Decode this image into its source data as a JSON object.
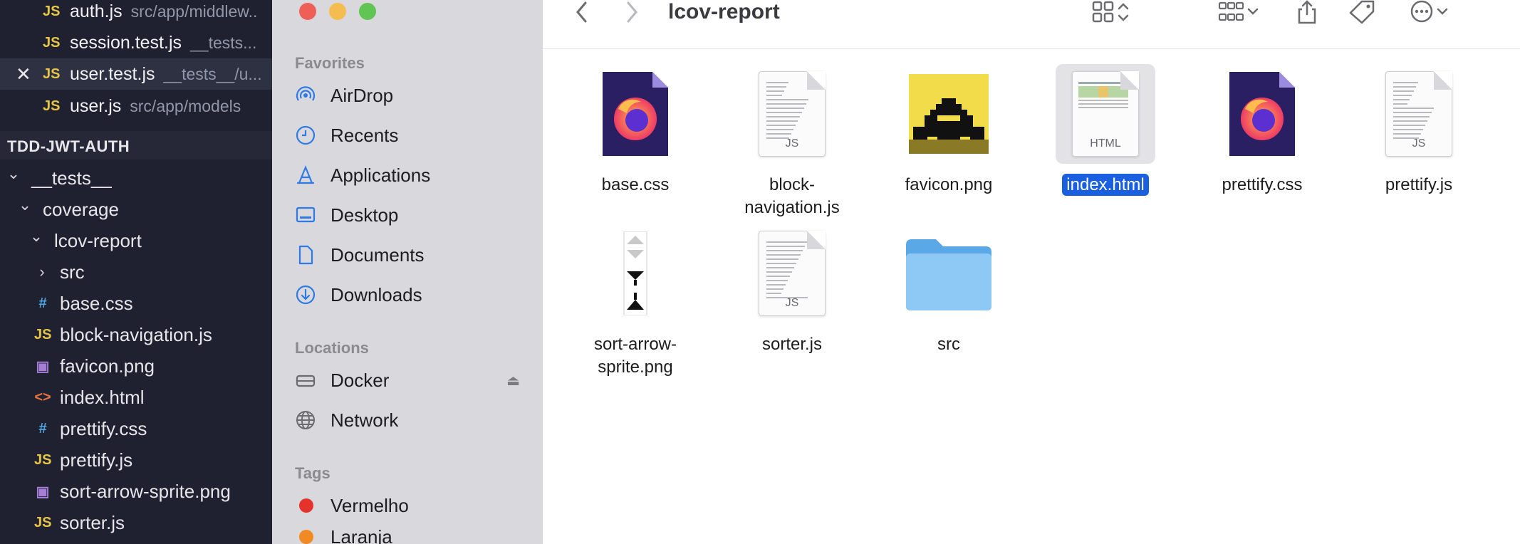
{
  "vscode": {
    "open_editors": [
      {
        "icon": "JS",
        "name": "auth.js",
        "path": "src/app/middlew..",
        "active": false
      },
      {
        "icon": "JS",
        "name": "session.test.js",
        "path": "__tests...",
        "active": false
      },
      {
        "icon": "JS",
        "name": "user.test.js",
        "path": "__tests__/u...",
        "active": true
      },
      {
        "icon": "JS",
        "name": "user.js",
        "path": "src/app/models",
        "active": false
      }
    ],
    "workspace_title": "TDD-JWT-AUTH",
    "tree": [
      {
        "label": "__tests__",
        "type": "folder",
        "expanded": true,
        "depth": 0
      },
      {
        "label": "coverage",
        "type": "folder",
        "expanded": true,
        "depth": 1
      },
      {
        "label": "lcov-report",
        "type": "folder",
        "expanded": true,
        "depth": 2
      },
      {
        "label": "src",
        "type": "folder",
        "expanded": false,
        "depth": 3
      },
      {
        "label": "base.css",
        "type": "css",
        "icon": "#",
        "depth": 3
      },
      {
        "label": "block-navigation.js",
        "type": "js",
        "icon": "JS",
        "depth": 3
      },
      {
        "label": "favicon.png",
        "type": "img",
        "icon": "▣",
        "depth": 3
      },
      {
        "label": "index.html",
        "type": "html",
        "icon": "<>",
        "depth": 3
      },
      {
        "label": "prettify.css",
        "type": "css",
        "icon": "#",
        "depth": 3
      },
      {
        "label": "prettify.js",
        "type": "js",
        "icon": "JS",
        "depth": 3
      },
      {
        "label": "sort-arrow-sprite.png",
        "type": "img",
        "icon": "▣",
        "depth": 3
      },
      {
        "label": "sorter.js",
        "type": "js",
        "icon": "JS",
        "depth": 3
      }
    ]
  },
  "finder": {
    "window_title": "lcov-report",
    "sidebar": {
      "favorites_label": "Favorites",
      "favorites": [
        {
          "label": "AirDrop",
          "icon": "airdrop-icon"
        },
        {
          "label": "Recents",
          "icon": "clock-icon"
        },
        {
          "label": "Applications",
          "icon": "applications-icon"
        },
        {
          "label": "Desktop",
          "icon": "desktop-icon"
        },
        {
          "label": "Documents",
          "icon": "document-icon"
        },
        {
          "label": "Downloads",
          "icon": "download-icon"
        }
      ],
      "locations_label": "Locations",
      "locations": [
        {
          "label": "Docker",
          "icon": "disk-icon"
        },
        {
          "label": "Network",
          "icon": "globe-icon"
        }
      ],
      "tags_label": "Tags",
      "tags": [
        {
          "label": "Vermelho",
          "color": "#e5322d"
        },
        {
          "label": "Laranja",
          "color": "#f08a24"
        }
      ]
    },
    "files": [
      {
        "name": "base.css",
        "kind": "firefox"
      },
      {
        "name": "block-\nnavigation.js",
        "kind": "js"
      },
      {
        "name": "favicon.png",
        "kind": "favicon"
      },
      {
        "name": "index.html",
        "kind": "html",
        "selected": true,
        "doc_label": "HTML"
      },
      {
        "name": "prettify.css",
        "kind": "firefox"
      },
      {
        "name": "prettify.js",
        "kind": "js"
      },
      {
        "name": "sort-arrow-\nsprite.png",
        "kind": "sprite"
      },
      {
        "name": "sorter.js",
        "kind": "js"
      },
      {
        "name": "src",
        "kind": "folder"
      }
    ],
    "js_doc_label": "JS"
  },
  "colors": {
    "selection": "#1a5fe0",
    "traffic_red": "#ed5f57",
    "traffic_yellow": "#f5bd4f",
    "traffic_green": "#61c554",
    "sidebar_accent": "#2f7ae5"
  }
}
